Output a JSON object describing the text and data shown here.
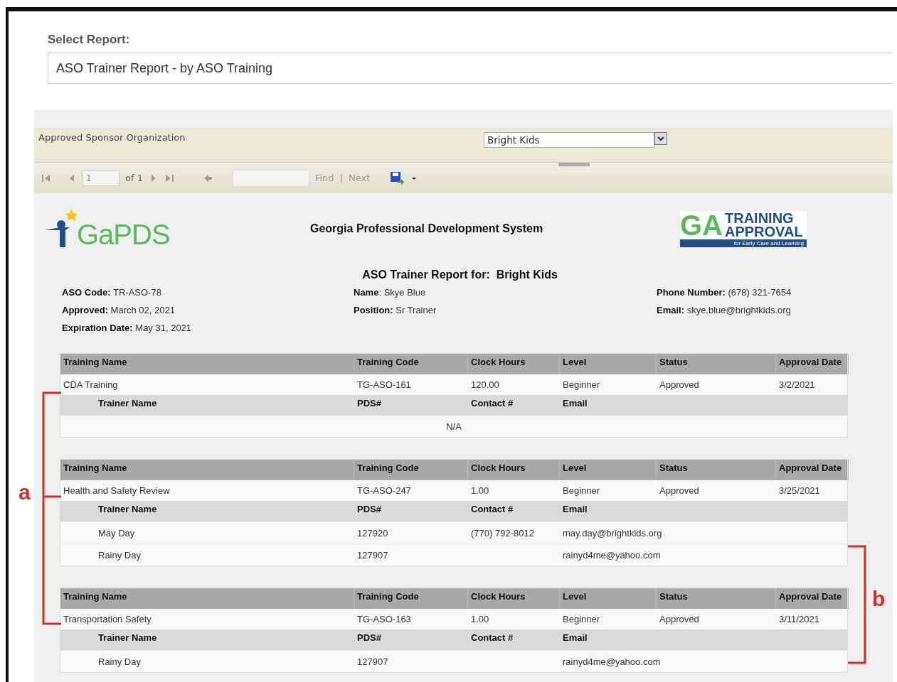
{
  "report_picker": {
    "label": "Select Report:",
    "value": "ASO Trainer Report - by ASO Training"
  },
  "parameters": {
    "label": "Approved Sponsor Organization",
    "value": "Bright Kids"
  },
  "toolbar": {
    "page": "1",
    "page_count": "of 1",
    "find": "Find",
    "separator": "|",
    "next": "Next"
  },
  "report": {
    "logo_left": "GaPDS",
    "system_title": "Georgia Professional Development System",
    "logo_right": {
      "big": "GA",
      "line1": "TRAINING",
      "line2": "APPROVAL",
      "tagline": "for Early Care and Learning"
    },
    "title": "ASO Trainer Report for:  Bright Kids",
    "details": [
      [
        "**ASO Code:** TR-ASO-78",
        "**Approved:** March 02, 2021",
        "**Expiration Date:** May 31, 2021"
      ],
      [
        "**Name**: Skye Blue",
        "**Position:** Sr Trainer"
      ],
      [
        "**Phone Number:** (678) 321-7654",
        "**Email:** skye.blue@brightkids.org"
      ]
    ],
    "trainings": [
      {
        "columns": [
          "Training Name",
          "Training Code",
          "Clock Hours",
          "Level",
          "Status",
          "Approval Date"
        ],
        "row": [
          "CDA Training",
          "TG-ASO-161",
          "120.00",
          "Beginner",
          "Approved",
          "3/2/2021"
        ],
        "trainer_columns": [
          "Trainer Name",
          "PDS#",
          "Contact #",
          "Email"
        ],
        "empty_text": "N/A"
      },
      {
        "columns": [
          "Training Name",
          "Training Code",
          "Clock Hours",
          "Level",
          "Status",
          "Approval Date"
        ],
        "row": [
          "Health and Safety Review",
          "TG-ASO-247",
          "1.00",
          "Beginner",
          "Approved",
          "3/25/2021"
        ],
        "trainer_columns": [
          "Trainer Name",
          "PDS#",
          "Contact #",
          "Email"
        ],
        "trainers": [
          {
            "name": "May Day",
            "pds": "127920",
            "contact": "(770) 792-8012",
            "email": "may.day@brightkids.org"
          },
          {
            "name": "Rainy Day",
            "pds": "127907",
            "email": "rainyd4me@yahoo.com"
          }
        ]
      },
      {
        "columns": [
          "Training Name",
          "Training Code",
          "Clock Hours",
          "Level",
          "Status",
          "Approval Date"
        ],
        "row": [
          "Transportation Safety",
          "TG-ASO-163",
          "1.00",
          "Beginner",
          "Approved",
          "3/11/2021"
        ],
        "trainer_columns": [
          "Trainer Name",
          "PDS#",
          "Contact #",
          "Email"
        ],
        "trainers": [
          {
            "name": "Rainy Day",
            "pds": "127907",
            "email": "rainyd4me@yahoo.com"
          }
        ]
      }
    ]
  },
  "annotations": [
    {
      "label": "a",
      "kind": "left"
    },
    {
      "label": "b",
      "kind": "right"
    }
  ]
}
